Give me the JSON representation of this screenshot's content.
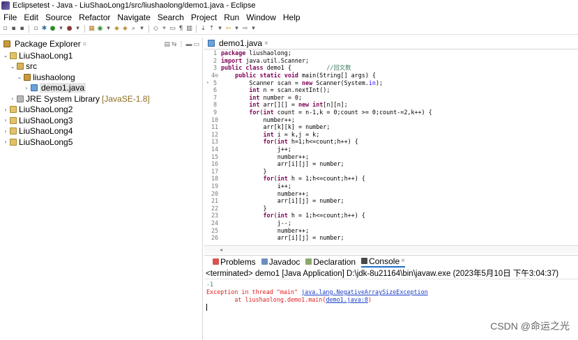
{
  "window": {
    "title": "Eclipsetest - Java - LiuShaoLong1/src/liushaolong/demo1.java - Eclipse"
  },
  "menu": [
    "File",
    "Edit",
    "Source",
    "Refactor",
    "Navigate",
    "Search",
    "Project",
    "Run",
    "Window",
    "Help"
  ],
  "explorer": {
    "title": "Package Explorer",
    "tab_suffix": "⌗",
    "items": [
      {
        "label": "LiuShaoLong1",
        "twisty": "⌄",
        "icon": "project-icon",
        "depth": 0
      },
      {
        "label": "src",
        "twisty": "⌄",
        "icon": "source-folder-icon",
        "depth": 1
      },
      {
        "label": "liushaolong",
        "twisty": "⌄",
        "icon": "package-icon",
        "depth": 2
      },
      {
        "label": "demo1.java",
        "twisty": "›",
        "icon": "java-file-icon",
        "depth": 3,
        "selected": true
      },
      {
        "label": "JRE System Library",
        "extra": "[JavaSE-1.8]",
        "twisty": "›",
        "icon": "library-icon",
        "depth": 1
      },
      {
        "label": "LiuShaoLong2",
        "twisty": "›",
        "icon": "project-icon",
        "depth": 0
      },
      {
        "label": "LiuShaoLong3",
        "twisty": "›",
        "icon": "project-icon",
        "depth": 0
      },
      {
        "label": "LiuShaoLong4",
        "twisty": "›",
        "icon": "project-icon",
        "depth": 0
      },
      {
        "label": "LiuShaoLong5",
        "twisty": "›",
        "icon": "project-icon",
        "depth": 0
      }
    ]
  },
  "editor": {
    "tab_label": "demo1.java",
    "tab_close": "×",
    "lines": [
      {
        "n": "1",
        "code": "package liushaolong;"
      },
      {
        "n": "2",
        "code": "import java.util.Scanner;"
      },
      {
        "n": "3",
        "code": "public class demo1 {          //回文数"
      },
      {
        "n": "4⊖",
        "code": "    public static void main(String[] args) {"
      },
      {
        "n": "5",
        "code": "        Scanner scan = new Scanner(System.in);"
      },
      {
        "n": "6",
        "code": "        int n = scan.nextInt();"
      },
      {
        "n": "7",
        "code": "        int number = 0;"
      },
      {
        "n": "8",
        "code": "        int arr[][] = new int[n][n];"
      },
      {
        "n": "9",
        "code": "        for(int count = n-1,k = 0;count >= 0;count-=2,k++) {"
      },
      {
        "n": "10",
        "code": "            number++;"
      },
      {
        "n": "11",
        "code": "            arr[k][k] = number;"
      },
      {
        "n": "12",
        "code": "            int i = k,j = k;"
      },
      {
        "n": "13",
        "code": "            for(int h=1;h<=count;h++) {"
      },
      {
        "n": "14",
        "code": "                j++;"
      },
      {
        "n": "15",
        "code": "                number++;"
      },
      {
        "n": "16",
        "code": "                arr[i][j] = number;"
      },
      {
        "n": "17",
        "code": "            }"
      },
      {
        "n": "18",
        "code": "            for(int h = 1;h<=count;h++) {"
      },
      {
        "n": "19",
        "code": "                i++;"
      },
      {
        "n": "20",
        "code": "                number++;"
      },
      {
        "n": "21",
        "code": "                arr[i][j] = number;"
      },
      {
        "n": "22",
        "code": "            }"
      },
      {
        "n": "23",
        "code": "            for(int h = 1;h<=count;h++) {"
      },
      {
        "n": "24",
        "code": "                j--;"
      },
      {
        "n": "25",
        "code": "                number++;"
      },
      {
        "n": "26",
        "code": "                arr[i][j] = number;"
      }
    ],
    "scroll_glyph": "◂"
  },
  "bottom_panel": {
    "tabs": [
      {
        "label": "Problems",
        "icon": "problems-icon",
        "active": false
      },
      {
        "label": "Javadoc",
        "icon": "javadoc-icon",
        "active": false
      },
      {
        "label": "Declaration",
        "icon": "declaration-icon",
        "active": false
      },
      {
        "label": "Console",
        "icon": "console-icon",
        "active": true
      }
    ],
    "status": "<terminated> demo1 [Java Application] D:\\jdk-8u21164\\bin\\javaw.exe (2023年5月10日 下午3:04:37)",
    "output": {
      "input_echo": "-1",
      "exception_prefix": "Exception in thread \"main\" ",
      "exception_class": "java.lang.NegativeArraySizeException",
      "trace_prefix": "        at liushaolong.demo1.main(",
      "trace_link": "demo1.java:8",
      "trace_suffix": ")"
    }
  },
  "watermark": "CSDN @命运之光",
  "colors": {
    "keyword": "#7f0055",
    "string": "#2a00ff",
    "comment": "#3f7f5f",
    "error": "#e01c1c",
    "link": "#1a3fc7",
    "input": "#2e8b57"
  }
}
